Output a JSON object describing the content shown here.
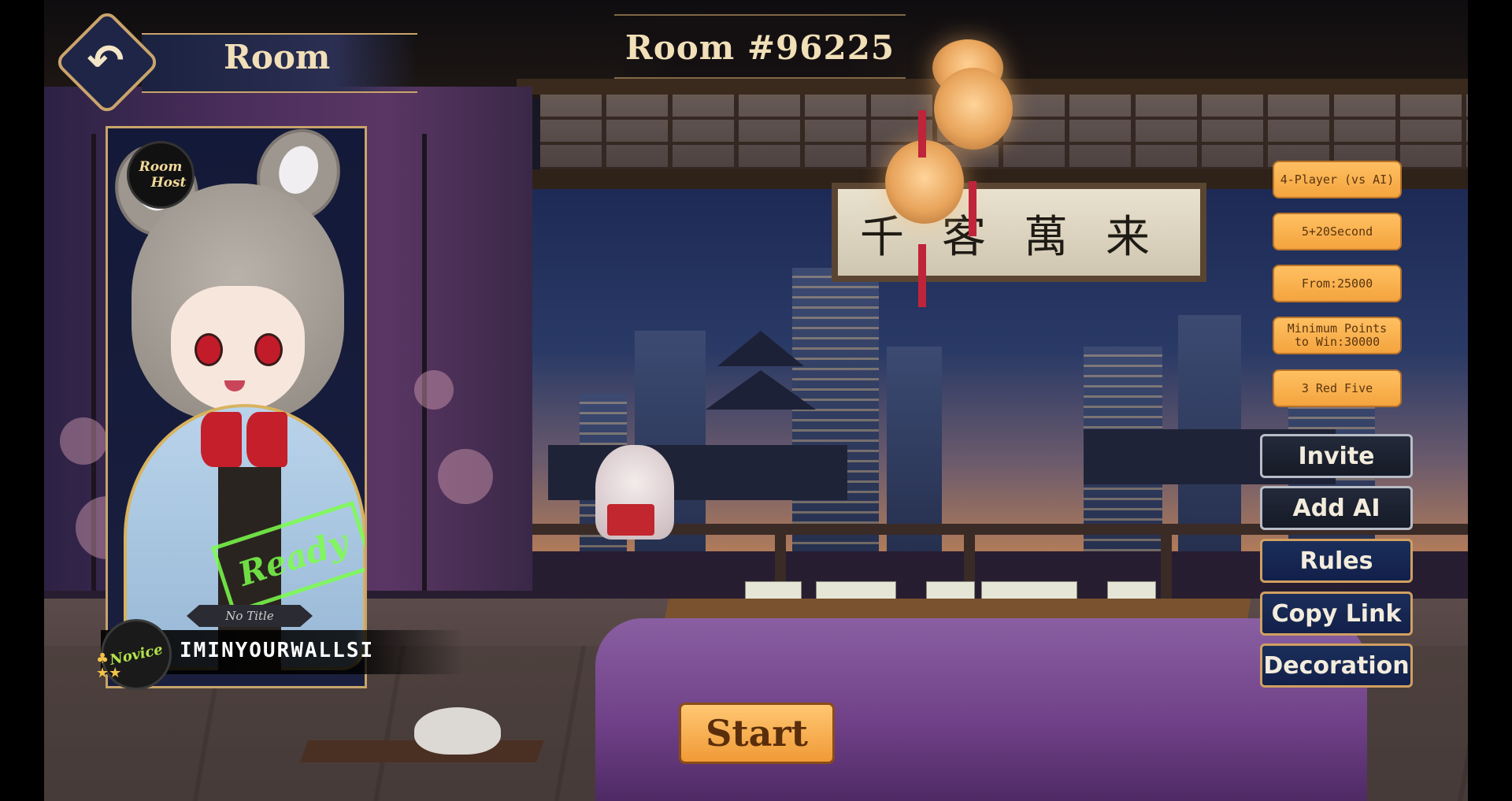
{
  "header": {
    "section_label": "Room",
    "room_title": "Room #96225"
  },
  "player": {
    "host_badge_line1": "Room",
    "host_badge_line2": "Host",
    "status_stamp": "Ready",
    "title": "No Title",
    "rank": "Novice",
    "name": "IMINYOURWALLSI"
  },
  "settings": [
    {
      "label": "4-Player (vs AI)"
    },
    {
      "label": "5+20Second"
    },
    {
      "label": "From:25000"
    },
    {
      "label": "Minimum Points\nto Win:30000"
    },
    {
      "label": "3 Red Five"
    }
  ],
  "actions": {
    "invite": "Invite",
    "add_ai": "Add AI",
    "rules": "Rules",
    "copy_link": "Copy Link",
    "decoration": "Decoration"
  },
  "start_label": "Start",
  "colors": {
    "accent_gold": "#c9a46b",
    "pill_orange": "#f4a43e",
    "ready_green": "#7cff4c",
    "button_navy": "#1b2e5a"
  }
}
